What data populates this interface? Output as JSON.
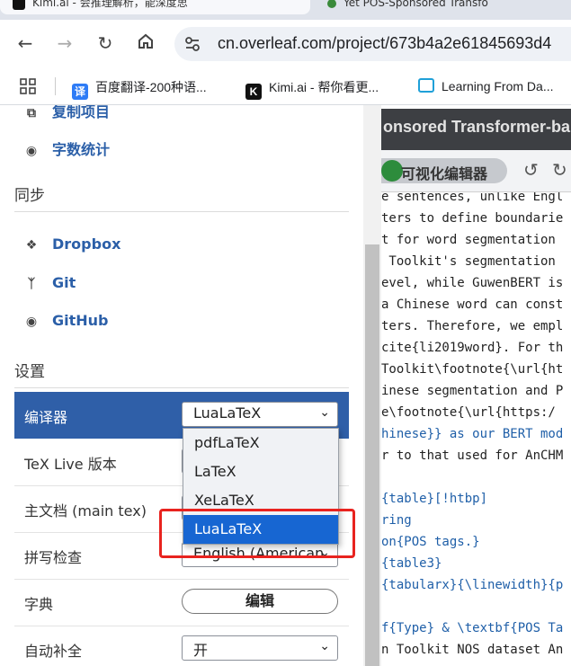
{
  "browser": {
    "tabs": [
      {
        "label": "Kimi.ai - 会推理解析，能深度思"
      },
      {
        "label": "Yet POS-Sponsored Transfo"
      }
    ],
    "url": "cn.overleaf.com/project/673b4a2e61845693d4",
    "bookmarks": [
      {
        "label": "百度翻译-200种语..."
      },
      {
        "label": "Kimi.ai - 帮你看更..."
      },
      {
        "label": "Learning From Da..."
      }
    ]
  },
  "sidebar": {
    "top_items": [
      {
        "label": "复制项目",
        "icon": "copy-icon"
      },
      {
        "label": "字数统计",
        "icon": "eye-icon"
      }
    ],
    "sync_heading": "同步",
    "sync_items": [
      {
        "label": "Dropbox",
        "icon": "dropbox-icon"
      },
      {
        "label": "Git",
        "icon": "git-icon"
      },
      {
        "label": "GitHub",
        "icon": "github-icon"
      }
    ],
    "settings_heading": "设置",
    "settings": [
      {
        "label": "编译器",
        "value": "LuaLaTeX"
      },
      {
        "label": "TeX Live 版本",
        "value": ""
      },
      {
        "label": "主文档 (main tex)",
        "value": ""
      },
      {
        "label": "拼写检查",
        "value": "English (American"
      },
      {
        "label": "字典",
        "value": "编辑"
      },
      {
        "label": "自动补全",
        "value": "开"
      }
    ]
  },
  "compiler_dropdown": {
    "options": [
      "pdfLaTeX",
      "LaTeX",
      "XeLaTeX",
      "LuaLaTeX"
    ],
    "selected": "LuaLaTeX"
  },
  "editor": {
    "title": "onsored Transformer-ba",
    "visual_toggle_label": "可视化编辑器",
    "code_lines": [
      "e sentences, unlike Engl",
      "ters to define boundarie",
      "t for word segmentation",
      " Toolkit's segmentation",
      "evel, while GuwenBERT is",
      "a Chinese word can const",
      "ters. Therefore, we empl",
      "cite{li2019word}. For th",
      "Toolkit\\footnote{\\url{ht",
      "inese segmentation and P",
      "e\\footnote{\\url{https:/",
      "hinese}} as our BERT mod",
      "r to that used for AnCHM",
      "",
      "{table}[!htbp]",
      "ring",
      "on{POS tags.}",
      "{table3}",
      "{tabularx}{\\linewidth}{p",
      "",
      "f{Type} & \\textbf{POS Ta",
      "n Toolkit NOS dataset An"
    ]
  },
  "colors": {
    "accent": "#2f5fa8",
    "selection": "#1766d2",
    "highlight_box": "#e8231f"
  }
}
